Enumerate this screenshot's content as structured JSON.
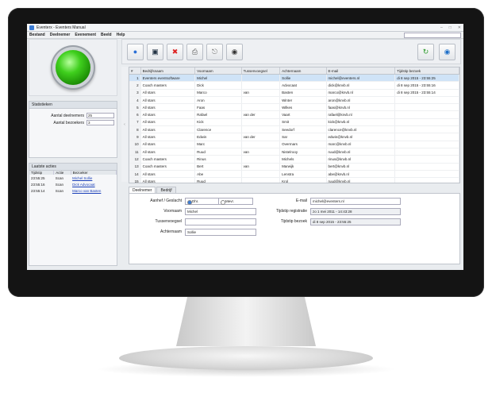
{
  "window": {
    "title": "Eventerx - Eventers Manual"
  },
  "menu": [
    "Bestand",
    "Deelnemer",
    "Evenement",
    "Beeld",
    "Help"
  ],
  "stats": {
    "title": "Statistieken",
    "rows": [
      {
        "label": "Aantal deelnemers",
        "value": "25"
      },
      {
        "label": "Aantal bezoekers",
        "value": "3"
      }
    ]
  },
  "activity": {
    "title": "Laatste acties",
    "columns": [
      "Tijdstip",
      "Actie",
      "Bezoeker"
    ],
    "rows": [
      [
        "23:55:25",
        "Scan",
        "Michel Sollie"
      ],
      [
        "23:55:16",
        "Scan",
        "Dick Advocaat"
      ],
      [
        "23:55:14",
        "Scan",
        "Marco van Basten"
      ]
    ]
  },
  "grid": {
    "columns": [
      "#",
      "Bedrijfsnaam",
      "Voornaam",
      "Tussenvoegsel",
      "Achternaam",
      "E-mail",
      "Tijdstip bezoek"
    ],
    "rows": [
      [
        "1",
        "Eventers eventsoftware",
        "Michel",
        "",
        "Sollie",
        "michel@eventers.nl",
        "di 8 sep 2015 - 23:55:25"
      ],
      [
        "2",
        "Coach masters",
        "Dick",
        "",
        "Advocaat",
        "dick@knvb.nl",
        "di 8 sep 2015 - 23:55:16"
      ],
      [
        "3",
        "All stars",
        "Marco",
        "van",
        "Basten",
        "marco@knvb.nl",
        "di 8 sep 2015 - 23:55:14"
      ],
      [
        "4",
        "All stars",
        "Aron",
        "",
        "Winter",
        "aron@knvb.nl",
        ""
      ],
      [
        "5",
        "All stars",
        "Faas",
        "",
        "Wilkes",
        "faas@knvb.nl",
        ""
      ],
      [
        "6",
        "All stars",
        "Rafael",
        "van der",
        "Vaart",
        "rafael@knvb.nl",
        ""
      ],
      [
        "7",
        "All stars",
        "Kick",
        "",
        "Smit",
        "kick@knvb.nl",
        ""
      ],
      [
        "8",
        "All stars",
        "Clarence",
        "",
        "Seedorf",
        "clarence@knvb.nl",
        ""
      ],
      [
        "9",
        "All stars",
        "Edwin",
        "van der",
        "Sar",
        "edwin@knvb.nl",
        ""
      ],
      [
        "10",
        "All stars",
        "Marc",
        "",
        "Overmars",
        "marc@knvb.nl",
        ""
      ],
      [
        "11",
        "All stars",
        "Ruud",
        "van",
        "Nistelrooy",
        "ruud@knvb.nl",
        ""
      ],
      [
        "12",
        "Coach masters",
        "Rinus",
        "",
        "Michels",
        "rinus@knvb.nl",
        ""
      ],
      [
        "13",
        "Coach masters",
        "Bert",
        "van",
        "Marwijk",
        "bert@knvb.nl",
        ""
      ],
      [
        "14",
        "All stars",
        "Abe",
        "",
        "Lenstra",
        "abe@knvb.nl",
        ""
      ],
      [
        "15",
        "All stars",
        "Ruud",
        "",
        "Krol",
        "ruud@knvb.nl",
        ""
      ]
    ]
  },
  "tabs": [
    "Deelnemer",
    "Bedrijf"
  ],
  "detail": {
    "gender_label": "Aanhef / Geslacht",
    "gender_options": [
      "Dhr.",
      "Mevr."
    ],
    "first_label": "Voornaam",
    "first_value": "Michel",
    "middle_label": "Tussenvoegsel",
    "middle_value": "",
    "last_label": "Achternaam",
    "last_value": "Sollie",
    "email_label": "E-mail",
    "email_value": "michel@eventers.nl",
    "reg_label": "Tijdstip registratie",
    "reg_value": "zo 1 mei 2011 - 14:43:28",
    "visit_label": "Tijdstip bezoek",
    "visit_value": "di 8 sep 2015 - 23:55:25"
  }
}
